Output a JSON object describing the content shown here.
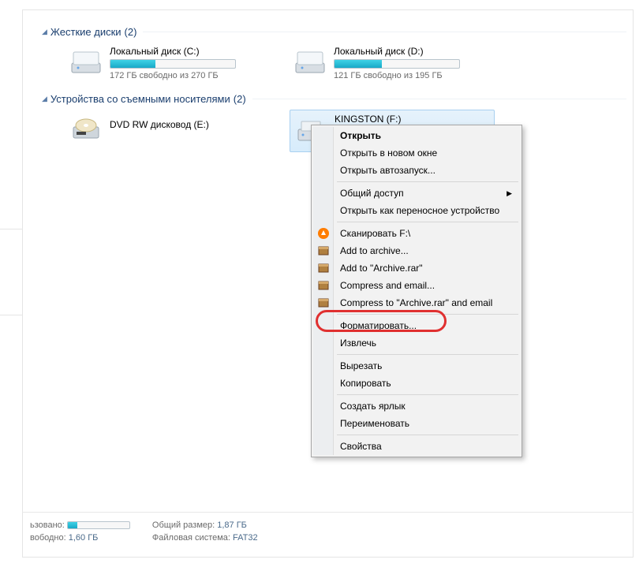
{
  "groups": {
    "hdd": {
      "label": "Жесткие диски",
      "count": "(2)"
    },
    "removable": {
      "label": "Устройства со съемными носителями",
      "count": "(2)"
    }
  },
  "drives": {
    "c": {
      "name": "Локальный диск (C:)",
      "sub": "172 ГБ свободно из 270 ГБ",
      "fill_pct": 36
    },
    "d": {
      "name": "Локальный диск (D:)",
      "sub": "121 ГБ свободно из 195 ГБ",
      "fill_pct": 38
    },
    "e": {
      "name": "DVD RW дисковод (E:)"
    },
    "f": {
      "name": "KINGSTON (F:)",
      "sub_partial": "1",
      "fill_pct": 15
    }
  },
  "context_menu": {
    "open": "Открыть",
    "open_new": "Открыть в новом окне",
    "autoplay": "Открыть автозапуск...",
    "share": "Общий доступ",
    "portable": "Открыть как переносное устройство",
    "scan": "Сканировать F:\\",
    "add_archive": "Add to archive...",
    "add_rar": "Add to \"Archive.rar\"",
    "compress_email": "Compress and email...",
    "compress_rar_email": "Compress to \"Archive.rar\" and email",
    "format": "Форматировать...",
    "eject": "Извлечь",
    "cut": "Вырезать",
    "copy": "Копировать",
    "shortcut": "Создать ярлык",
    "rename": "Переименовать",
    "properties": "Свойства"
  },
  "status": {
    "used_label": "ьзовано:",
    "free_label": "вободно:",
    "free_val": "1,60 ГБ",
    "total_label": "Общий размер:",
    "total_val": "1,87 ГБ",
    "fs_label": "Файловая система:",
    "fs_val": "FAT32",
    "used_bar_pct": 15
  }
}
